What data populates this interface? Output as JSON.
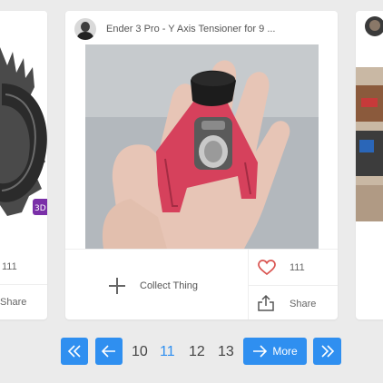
{
  "main_card": {
    "title": "Ender 3 Pro - Y Axis Tensioner for 9 ...",
    "collect_label": "Collect Thing",
    "likes": "111",
    "share_label": "Share"
  },
  "left_card": {
    "likes": "111",
    "share_label": "Share"
  },
  "pagination": {
    "pages": [
      "10",
      "11",
      "12",
      "13"
    ],
    "current": "11",
    "more_label": "More"
  },
  "colors": {
    "accent": "#2f8ff0",
    "heart": "#d9534f",
    "background": "#ebebeb"
  }
}
